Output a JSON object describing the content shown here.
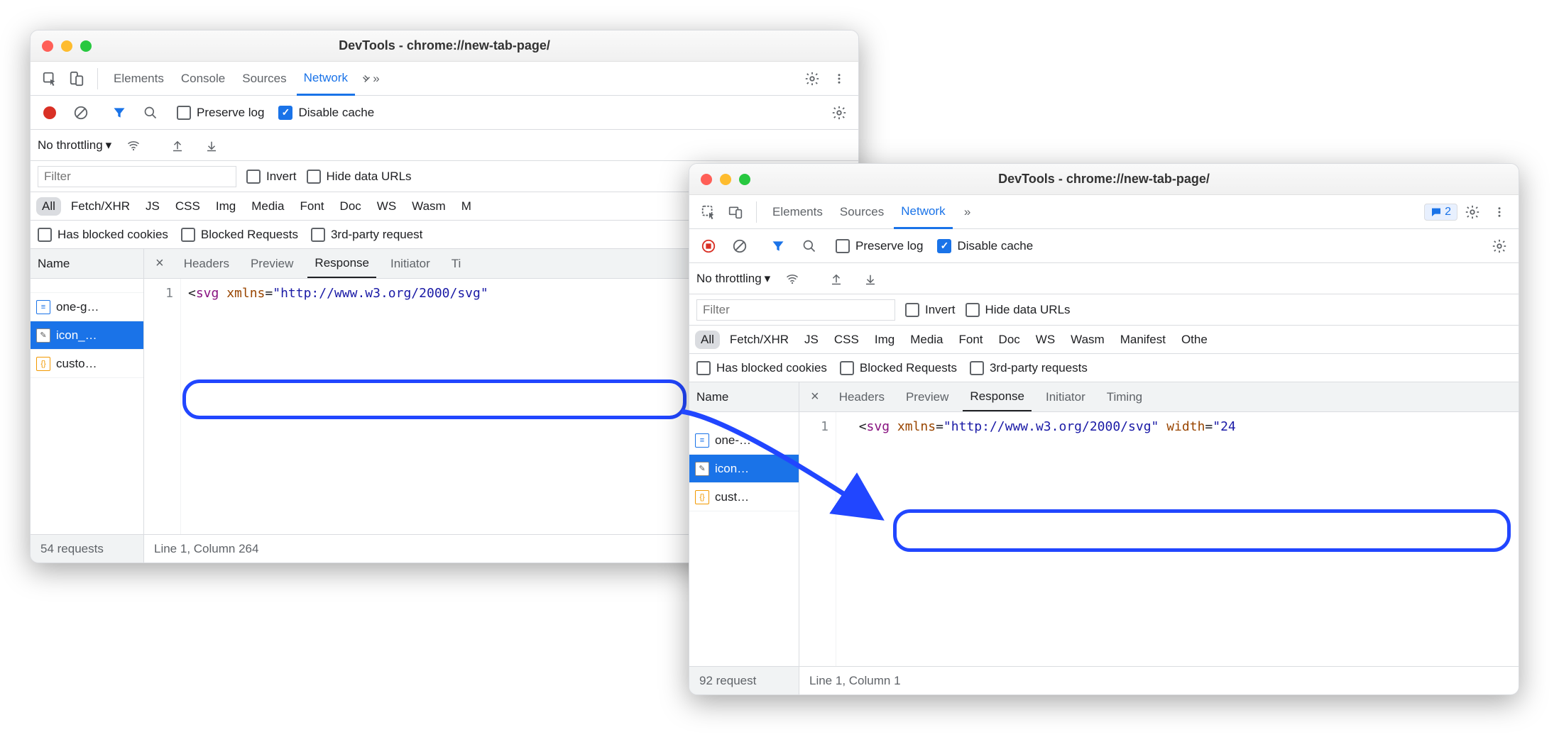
{
  "win1": {
    "title": "DevTools - chrome://new-tab-page/",
    "tabs": {
      "elements": "Elements",
      "console": "Console",
      "sources": "Sources",
      "network": "Network"
    },
    "preserve_log": "Preserve log",
    "disable_cache": "Disable cache",
    "no_throttling": "No throttling",
    "filter_ph": "Filter",
    "invert": "Invert",
    "hide_data_urls": "Hide data URLs",
    "pills": {
      "all": "All",
      "fetch": "Fetch/XHR",
      "js": "JS",
      "css": "CSS",
      "img": "Img",
      "media": "Media",
      "font": "Font",
      "doc": "Doc",
      "ws": "WS",
      "wasm": "Wasm",
      "m": "M"
    },
    "chkrow": {
      "blocked_cookies": "Has blocked cookies",
      "blocked_req": "Blocked Requests",
      "third_party": "3rd-party request"
    },
    "name_header": "Name",
    "requests": {
      "r1": "one-g…",
      "r2": "icon_…",
      "r3": "custo…"
    },
    "detail_tabs": {
      "headers": "Headers",
      "preview": "Preview",
      "response": "Response",
      "initiator": "Initiator",
      "timing": "Ti"
    },
    "line_no": "1",
    "status1": "54 requests",
    "status2": "Line 1, Column 264"
  },
  "win2": {
    "title": "DevTools - chrome://new-tab-page/",
    "tabs": {
      "elements": "Elements",
      "sources": "Sources",
      "network": "Network"
    },
    "badge": "2",
    "preserve_log": "Preserve log",
    "disable_cache": "Disable cache",
    "no_throttling": "No throttling",
    "filter_ph": "Filter",
    "invert": "Invert",
    "hide_data_urls": "Hide data URLs",
    "pills": {
      "all": "All",
      "fetch": "Fetch/XHR",
      "js": "JS",
      "css": "CSS",
      "img": "Img",
      "media": "Media",
      "font": "Font",
      "doc": "Doc",
      "ws": "WS",
      "wasm": "Wasm",
      "manifest": "Manifest",
      "other": "Othe"
    },
    "chkrow": {
      "blocked_cookies": "Has blocked cookies",
      "blocked_req": "Blocked Requests",
      "third_party": "3rd-party requests"
    },
    "name_header": "Name",
    "requests": {
      "r1": "one-…",
      "r2": "icon…",
      "r3": "cust…"
    },
    "detail_tabs": {
      "headers": "Headers",
      "preview": "Preview",
      "response": "Response",
      "initiator": "Initiator",
      "timing": "Timing"
    },
    "line_no": "1",
    "status1": "92 request",
    "status2": "Line 1, Column 1"
  },
  "code1": {
    "lt": "<",
    "tag": "svg ",
    "attr1": "xmlns",
    "eq": "=",
    "q": "\"",
    "url": "http://www.w3.org/2000/svg",
    "q2": "\""
  },
  "code2": {
    "lt": "<",
    "tag": "svg ",
    "attr1": "xmlns",
    "eq": "=",
    "q": "\"",
    "url": "http://www.w3.org/2000/svg",
    "q2": "\" ",
    "attr2": "width",
    "eq2": "=",
    "q3": "\"",
    "val2": "24"
  }
}
